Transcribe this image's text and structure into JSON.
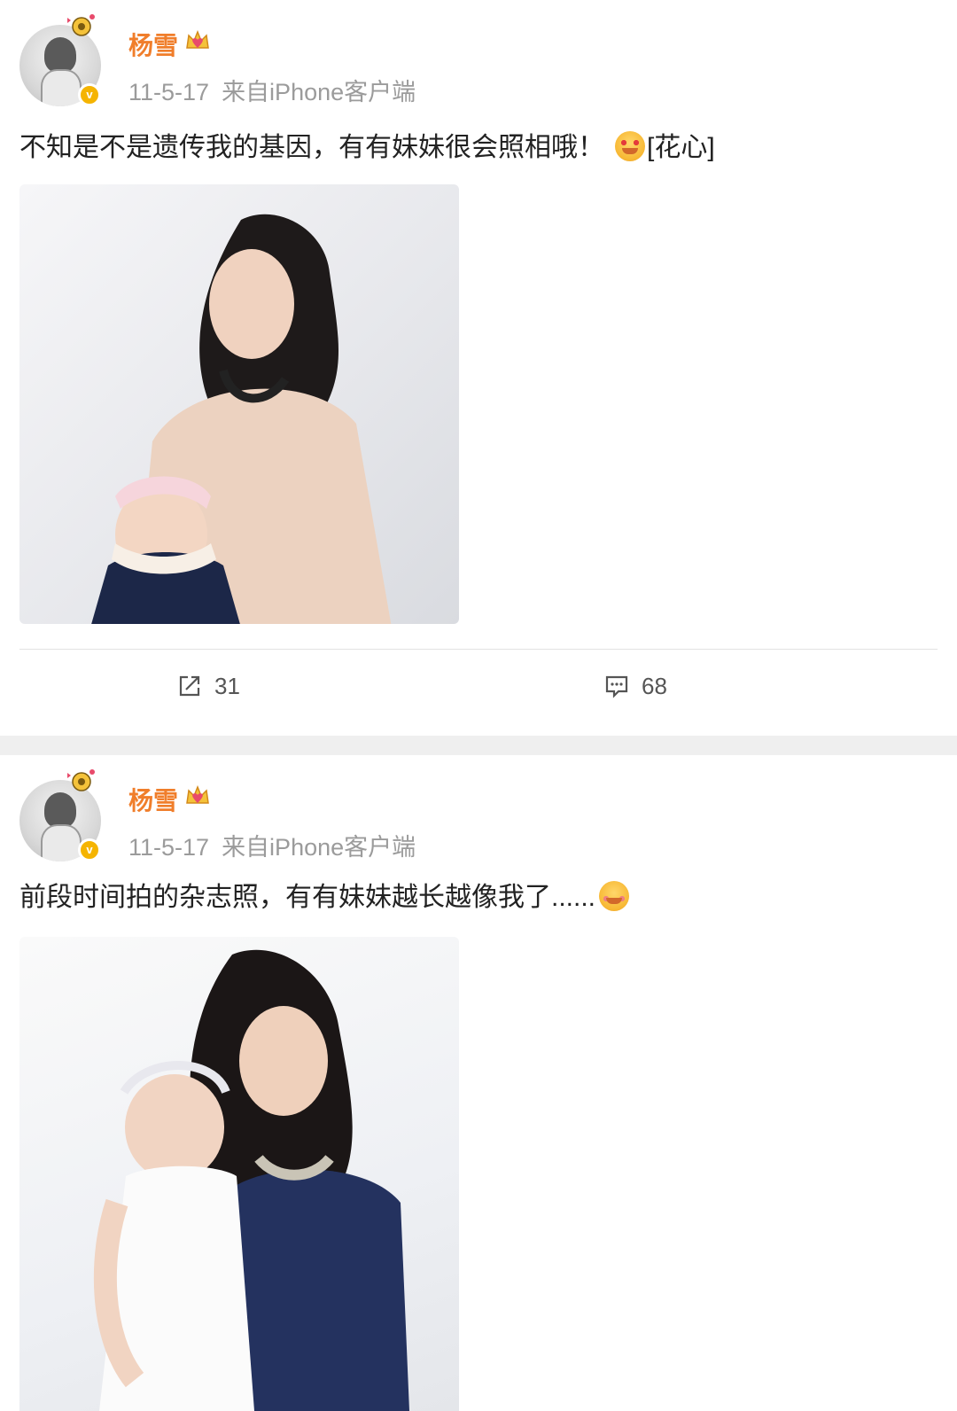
{
  "posts": [
    {
      "author": "杨雪",
      "date": "11-5-17",
      "source": "来自iPhone客户端",
      "text_before_emoji": "不知是不是遗传我的基因，有有妹妹很会照相哦！",
      "emoji": "smiling-hearts-emoji",
      "text_after_emoji": "[花心]",
      "image": "photo of woman in pale pink top holding baby with pink headband",
      "repost_count": "31",
      "comment_count": "68"
    },
    {
      "author": "杨雪",
      "date": "11-5-17",
      "source": "来自iPhone客户端",
      "text_before_emoji": "前段时间拍的杂志照，有有妹妹越长越像我了......",
      "emoji": "blushing-emoji",
      "text_after_emoji": "",
      "image": "photo of woman in navy dress holding baby in white dress"
    }
  ],
  "colors": {
    "name": "#f07e2b",
    "meta": "#9b9b9b",
    "verified": "#f5b400",
    "separator": "#efefef"
  }
}
